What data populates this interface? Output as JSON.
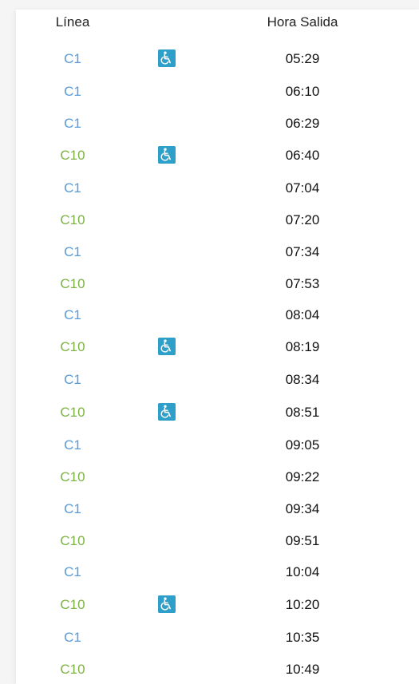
{
  "headers": {
    "line": "Línea",
    "departure": "Hora Salida"
  },
  "colors": {
    "C1": "#5b9bd5",
    "C10": "#7cb342",
    "accessible_icon_bg": "#2e9fc9"
  },
  "rows": [
    {
      "line": "C1",
      "accessible": true,
      "time": "05:29"
    },
    {
      "line": "C1",
      "accessible": false,
      "time": "06:10"
    },
    {
      "line": "C1",
      "accessible": false,
      "time": "06:29"
    },
    {
      "line": "C10",
      "accessible": true,
      "time": "06:40"
    },
    {
      "line": "C1",
      "accessible": false,
      "time": "07:04"
    },
    {
      "line": "C10",
      "accessible": false,
      "time": "07:20"
    },
    {
      "line": "C1",
      "accessible": false,
      "time": "07:34"
    },
    {
      "line": "C10",
      "accessible": false,
      "time": "07:53"
    },
    {
      "line": "C1",
      "accessible": false,
      "time": "08:04"
    },
    {
      "line": "C10",
      "accessible": true,
      "time": "08:19"
    },
    {
      "line": "C1",
      "accessible": false,
      "time": "08:34"
    },
    {
      "line": "C10",
      "accessible": true,
      "time": "08:51"
    },
    {
      "line": "C1",
      "accessible": false,
      "time": "09:05"
    },
    {
      "line": "C10",
      "accessible": false,
      "time": "09:22"
    },
    {
      "line": "C1",
      "accessible": false,
      "time": "09:34"
    },
    {
      "line": "C10",
      "accessible": false,
      "time": "09:51"
    },
    {
      "line": "C1",
      "accessible": false,
      "time": "10:04"
    },
    {
      "line": "C10",
      "accessible": true,
      "time": "10:20"
    },
    {
      "line": "C1",
      "accessible": false,
      "time": "10:35"
    },
    {
      "line": "C10",
      "accessible": false,
      "time": "10:49"
    }
  ]
}
